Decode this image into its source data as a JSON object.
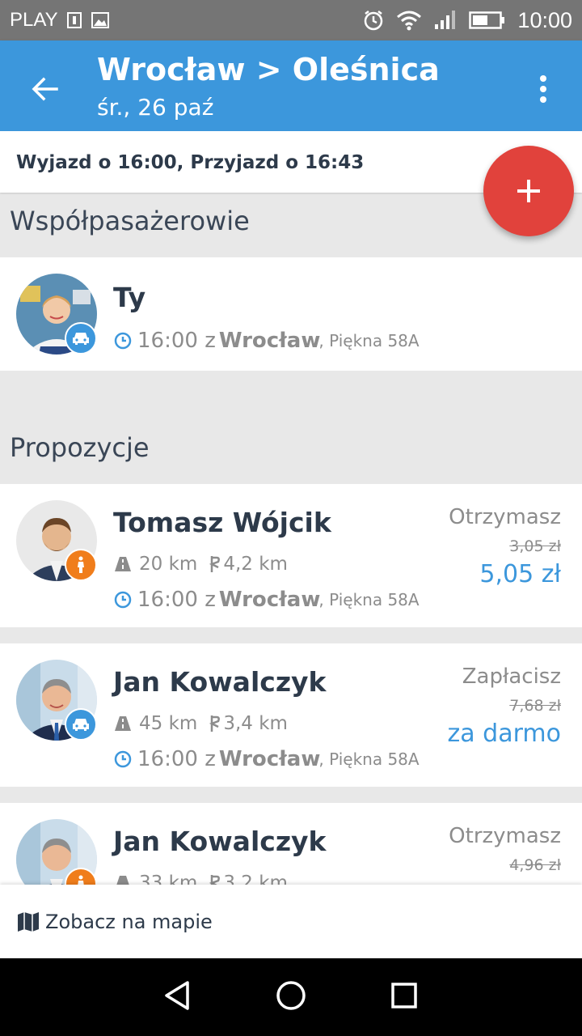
{
  "status_bar": {
    "carrier": "PLAY",
    "time": "10:00"
  },
  "app_bar": {
    "title": "Wrocław > Oleśnica",
    "subtitle": "śr., 26 paź"
  },
  "trip": {
    "summary": "Wyjazd o 16:00, Przyjazd o 16:43"
  },
  "sections": {
    "copassengers": "Współpasażerowie",
    "proposals": "Propozycje"
  },
  "me": {
    "name": "Ty",
    "time": "16:00 z",
    "place": "Wrocław",
    "address": ", Piękna 58A",
    "role_icon": "car-icon"
  },
  "proposals": [
    {
      "name": "Tomasz Wójcik",
      "distance": "20 km",
      "walk": "4,2 km",
      "time": "16:00 z",
      "place": "Wrocław",
      "address": ", Piękna 58A",
      "price_label": "Otrzymasz",
      "price_old": "3,05 zł",
      "price_new": "5,05 zł",
      "role_icon": "pedestrian-icon"
    },
    {
      "name": "Jan Kowalczyk",
      "distance": "45 km",
      "walk": "3,4 km",
      "time": "16:00 z",
      "place": "Wrocław",
      "address": ", Piękna 58A",
      "price_label": "Zapłacisz",
      "price_old": "7,68 zł",
      "price_new": "za darmo",
      "role_icon": "car-icon"
    },
    {
      "name": "Jan Kowalczyk",
      "distance": "33 km",
      "walk": "3,2 km",
      "price_label": "Otrzymasz",
      "price_old": "4,96 zł",
      "role_icon": "pedestrian-icon"
    }
  ],
  "bottom_bar": {
    "label": "Zobacz na mapie"
  },
  "colors": {
    "primary": "#3c97dc",
    "fab": "#e1423c",
    "pedestrian_badge": "#f07d1b"
  }
}
